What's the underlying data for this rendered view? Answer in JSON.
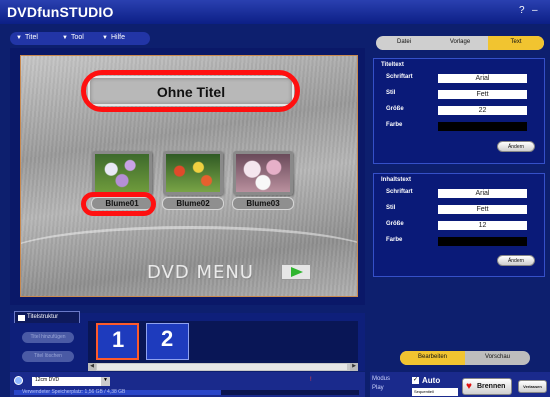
{
  "app": {
    "title": "DVDfunSTUDIO",
    "help_btn": "?",
    "min_btn": "–",
    "close_btn": "×"
  },
  "menu": {
    "items": [
      {
        "label": "Titel"
      },
      {
        "label": "Tool"
      },
      {
        "label": "Hilfe"
      }
    ]
  },
  "preview": {
    "title": "Ohne Titel",
    "buttons": [
      {
        "label": "Blume01"
      },
      {
        "label": "Blume02"
      },
      {
        "label": "Blume03"
      }
    ],
    "dvd_menu_text": "DVD MENU"
  },
  "structure": {
    "tab_label": "Titelstruktur",
    "side_buttons": [
      "Titel hinzufügen",
      "Titel löschen"
    ],
    "chapters": [
      "1",
      "2"
    ]
  },
  "status": {
    "disc_type": "12cm DVD",
    "capacity_text": "Verwendeter Speicherplatz: 1,56 GB / 4,38 GB",
    "progress_fraction": 0.6,
    "warn_text": "!"
  },
  "right": {
    "tabs": [
      {
        "label": "Datei"
      },
      {
        "label": "Vorlage"
      },
      {
        "label": "Text",
        "active": true
      }
    ],
    "titeltext": {
      "heading": "Titeltext",
      "schriftart_label": "Schriftart",
      "schriftart": "Arial",
      "stil_label": "Stil",
      "stil": "Fett",
      "groesse_label": "Größe",
      "groesse": "22",
      "farbe_label": "Farbe",
      "andern": "Ändern"
    },
    "inhaltstext": {
      "heading": "Inhaltstext",
      "schriftart_label": "Schriftart",
      "schriftart": "Arial",
      "stil_label": "Stil",
      "stil": "Fett",
      "groesse_label": "Größe",
      "groesse": "12",
      "farbe_label": "Farbe",
      "andern": "Ändern"
    },
    "bottom_tabs": [
      {
        "label": "Bearbeiten",
        "active": true
      },
      {
        "label": "Vorschau"
      }
    ],
    "modus_label": "Modus",
    "play_label": "Play",
    "auto_label": "Auto",
    "auto_checked": true,
    "play_mode": "Sequentiell",
    "brennen": "Brennen",
    "verlassen": "Verlassen"
  }
}
